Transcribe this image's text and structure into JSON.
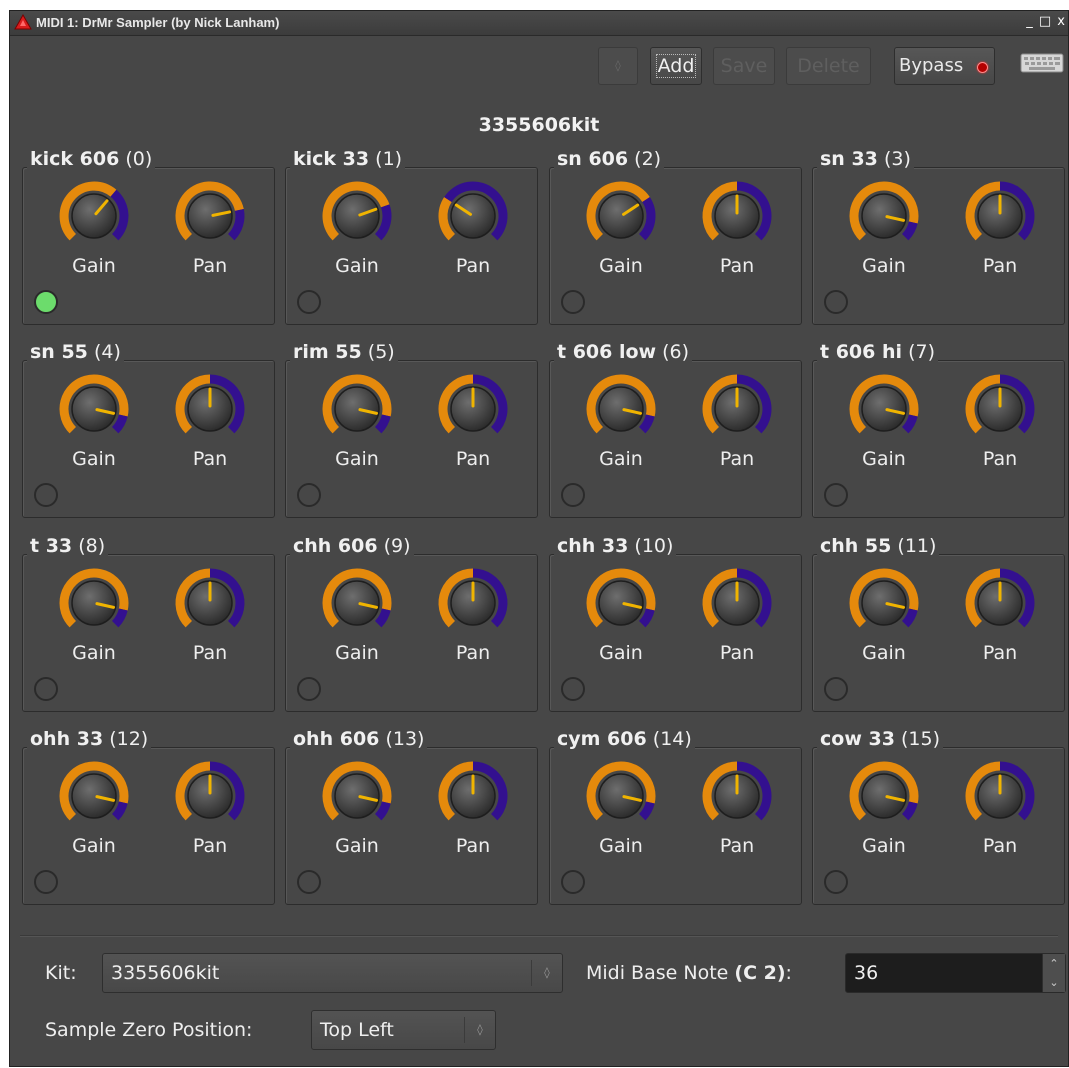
{
  "window": {
    "title": "MIDI 1: DrMr Sampler (by Nick Lanham)",
    "controls": [
      "_",
      "□",
      "x"
    ]
  },
  "toolbar": {
    "spinner_arrows": "◊",
    "add_label": "Add",
    "save_label": "Save",
    "delete_label": "Delete",
    "bypass_label": "Bypass",
    "bypass_led_color": "#b40000",
    "keyboard_icon": "keyboard-icon"
  },
  "kit_title": "3355606kit",
  "colors": {
    "knob_arc_value": "#e58a0c",
    "knob_arc_rest": "#33108f",
    "knob_indicator": "#f0b400",
    "led_on": "#6cdc6c",
    "background": "#474747"
  },
  "pads": [
    {
      "name": "kick 606",
      "index": "(0)",
      "gain_label": "Gain",
      "pan_label": "Pan",
      "gain": 0.65,
      "pan": 0.79,
      "led_on": true
    },
    {
      "name": "kick 33",
      "index": "(1)",
      "gain_label": "Gain",
      "pan_label": "Pan",
      "gain": 0.76,
      "pan": 0.29,
      "led_on": false
    },
    {
      "name": "sn 606",
      "index": "(2)",
      "gain_label": "Gain",
      "pan_label": "Pan",
      "gain": 0.71,
      "pan": 0.5,
      "led_on": false
    },
    {
      "name": "sn 33",
      "index": "(3)",
      "gain_label": "Gain",
      "pan_label": "Pan",
      "gain": 0.88,
      "pan": 0.5,
      "led_on": false
    },
    {
      "name": "sn 55",
      "index": "(4)",
      "gain_label": "Gain",
      "pan_label": "Pan",
      "gain": 0.88,
      "pan": 0.5,
      "led_on": false
    },
    {
      "name": "rim 55",
      "index": "(5)",
      "gain_label": "Gain",
      "pan_label": "Pan",
      "gain": 0.88,
      "pan": 0.5,
      "led_on": false
    },
    {
      "name": "t 606 low",
      "index": "(6)",
      "gain_label": "Gain",
      "pan_label": "Pan",
      "gain": 0.88,
      "pan": 0.5,
      "led_on": false
    },
    {
      "name": "t 606 hi",
      "index": "(7)",
      "gain_label": "Gain",
      "pan_label": "Pan",
      "gain": 0.88,
      "pan": 0.5,
      "led_on": false
    },
    {
      "name": "t 33",
      "index": "(8)",
      "gain_label": "Gain",
      "pan_label": "Pan",
      "gain": 0.88,
      "pan": 0.5,
      "led_on": false
    },
    {
      "name": "chh 606",
      "index": "(9)",
      "gain_label": "Gain",
      "pan_label": "Pan",
      "gain": 0.88,
      "pan": 0.5,
      "led_on": false
    },
    {
      "name": "chh 33",
      "index": "(10)",
      "gain_label": "Gain",
      "pan_label": "Pan",
      "gain": 0.88,
      "pan": 0.5,
      "led_on": false
    },
    {
      "name": "chh 55",
      "index": "(11)",
      "gain_label": "Gain",
      "pan_label": "Pan",
      "gain": 0.88,
      "pan": 0.5,
      "led_on": false
    },
    {
      "name": "ohh 33",
      "index": "(12)",
      "gain_label": "Gain",
      "pan_label": "Pan",
      "gain": 0.88,
      "pan": 0.5,
      "led_on": false
    },
    {
      "name": "ohh 606",
      "index": "(13)",
      "gain_label": "Gain",
      "pan_label": "Pan",
      "gain": 0.88,
      "pan": 0.5,
      "led_on": false
    },
    {
      "name": "cym 606",
      "index": "(14)",
      "gain_label": "Gain",
      "pan_label": "Pan",
      "gain": 0.88,
      "pan": 0.5,
      "led_on": false
    },
    {
      "name": "cow 33",
      "index": "(15)",
      "gain_label": "Gain",
      "pan_label": "Pan",
      "gain": 0.88,
      "pan": 0.5,
      "led_on": false
    }
  ],
  "bottom": {
    "kit_label": "Kit:",
    "kit_value": "3355606kit",
    "base_note_label": "Midi Base Note",
    "base_note_name": "(C 2)",
    "base_note_colon": ":",
    "base_note_value": "36",
    "zero_pos_label": "Sample Zero Position:",
    "zero_pos_value": "Top Left",
    "combo_arrows": "◊",
    "spin_up": "⌃",
    "spin_down": "⌄"
  }
}
